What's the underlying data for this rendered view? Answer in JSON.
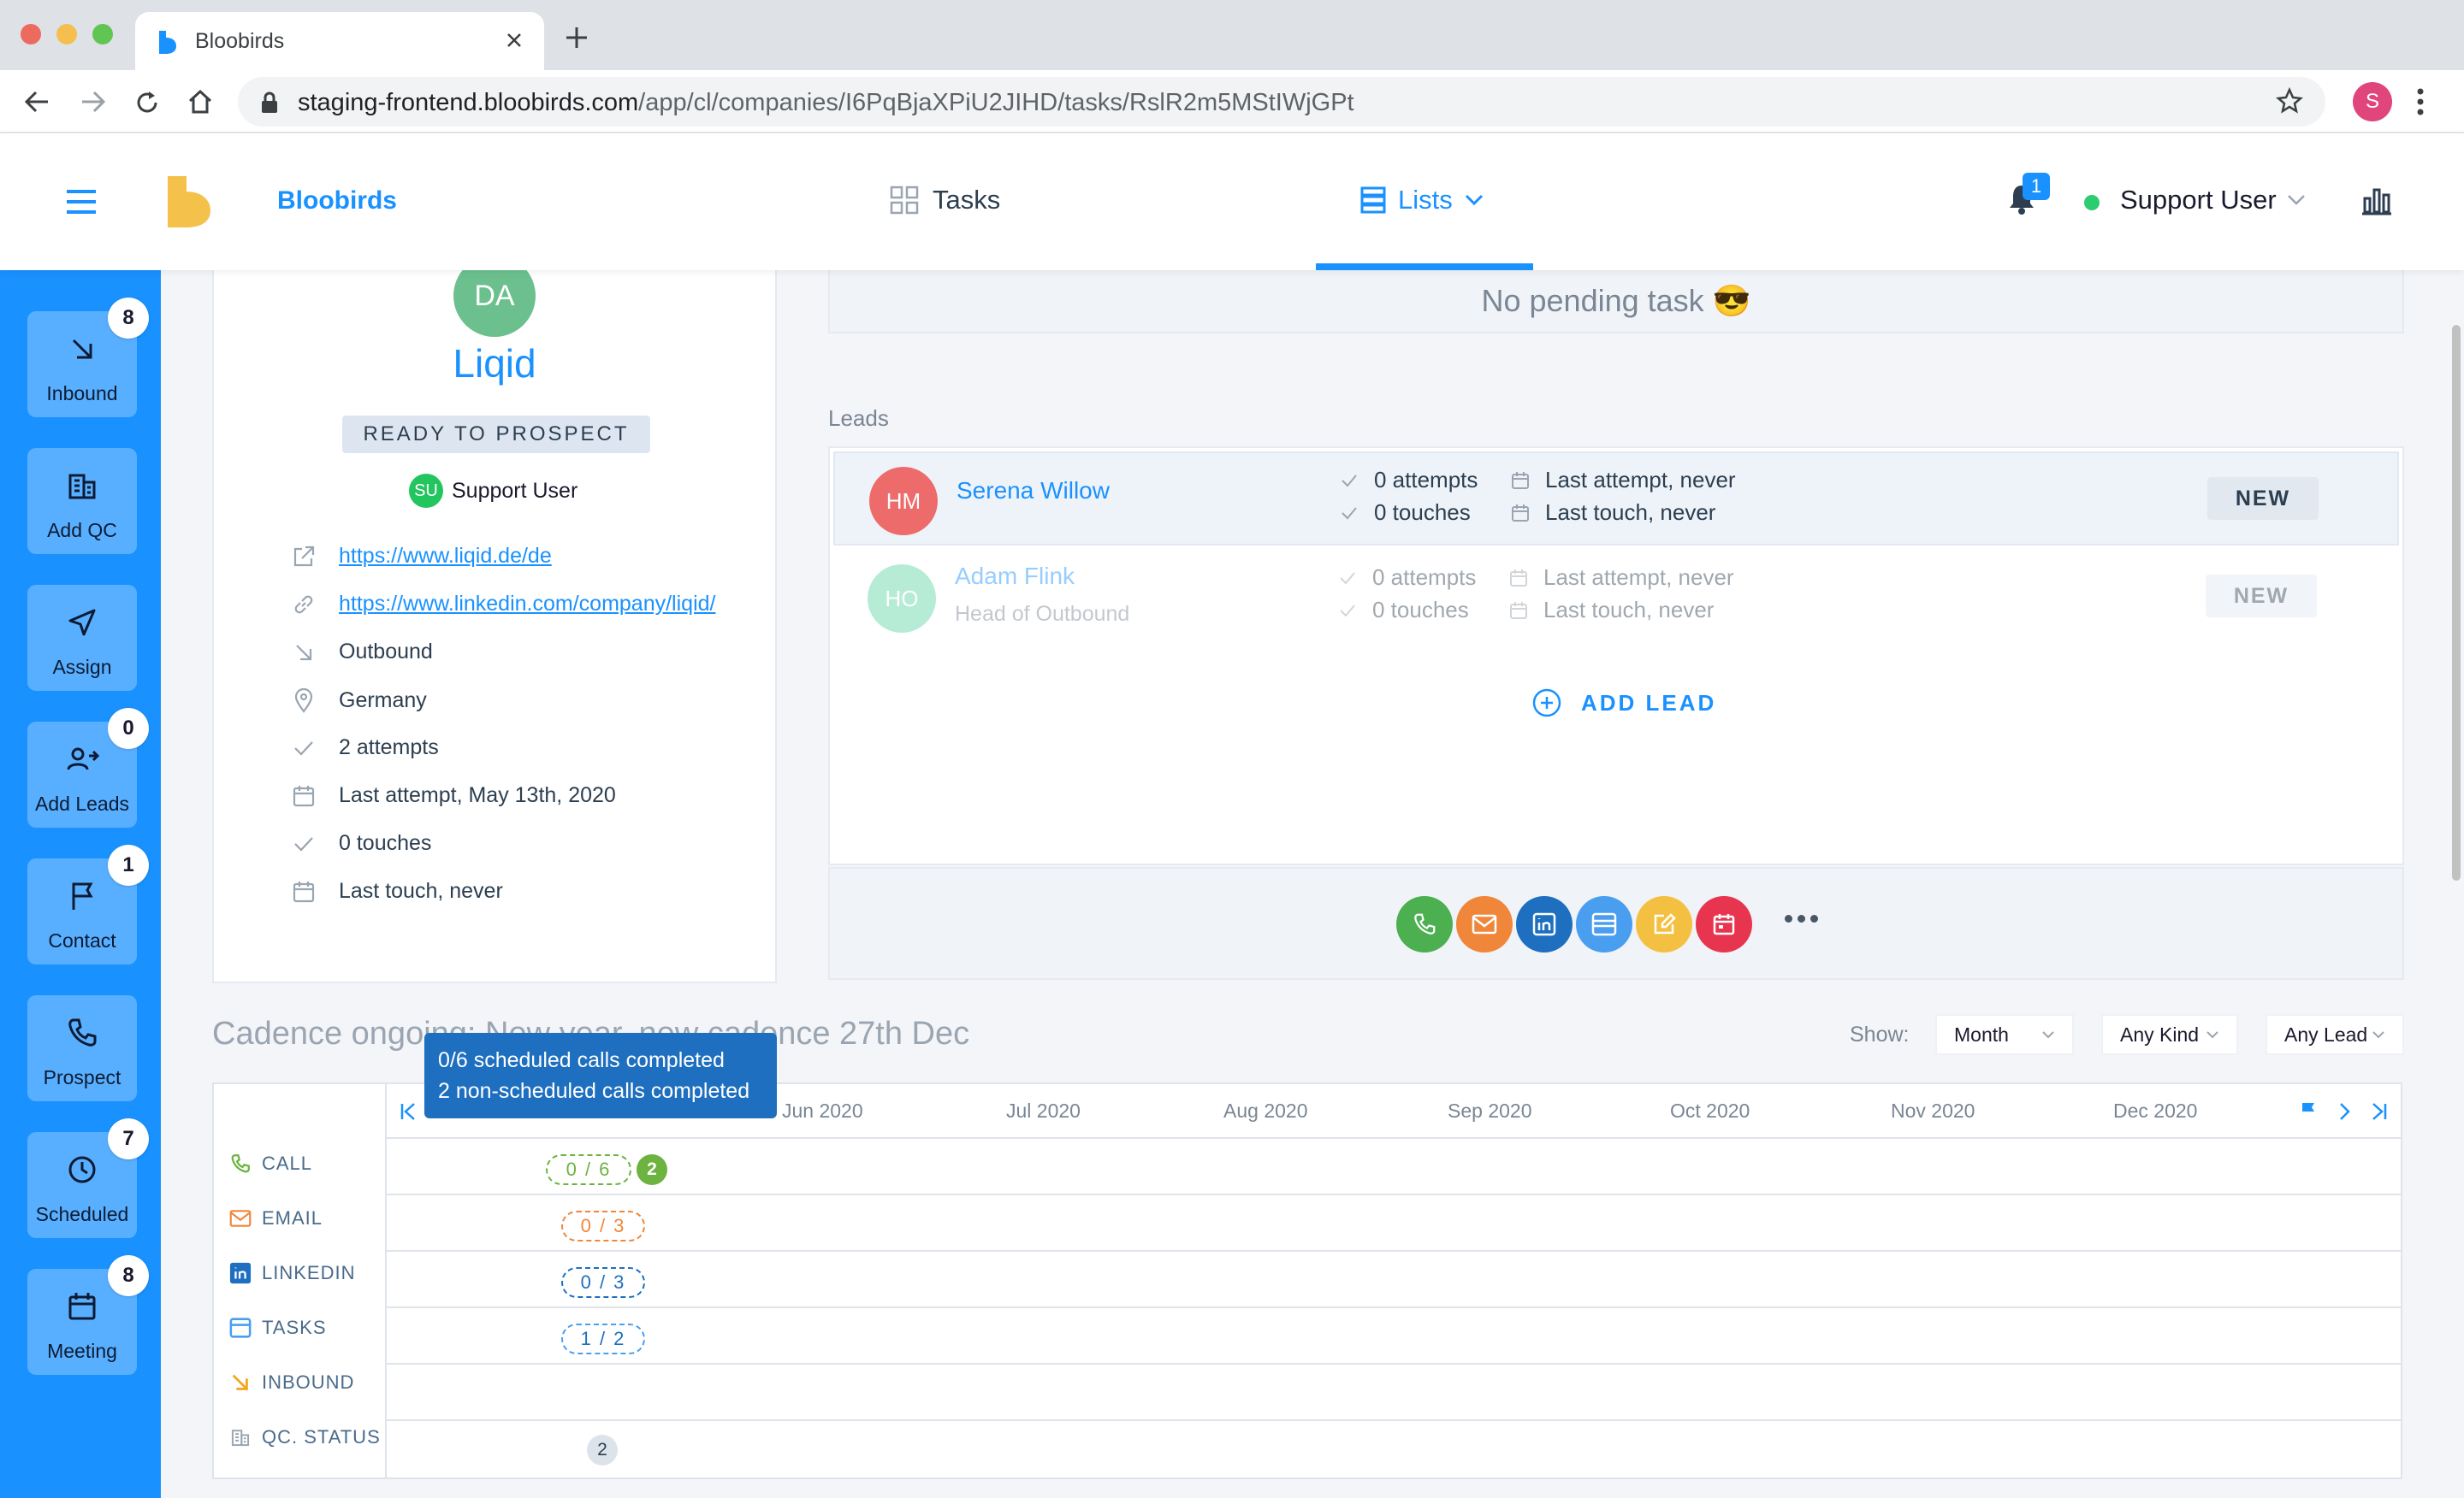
{
  "browser": {
    "tab_title": "Bloobirds",
    "url_host": "staging-frontend.bloobirds.com",
    "url_path": "/app/cl/companies/I6PqBjaXPiU2JIHD/tasks/RslR2m5MStIWjGPt",
    "profile_initial": "S"
  },
  "header": {
    "brand": "Bloobirds",
    "nav_tasks": "Tasks",
    "nav_lists": "Lists",
    "notifications_count": "1",
    "user_name": "Support User"
  },
  "sidebar": [
    {
      "label": "Inbound",
      "badge": "8",
      "icon": "arrow-down-right-icon"
    },
    {
      "label": "Add QC",
      "badge": "",
      "icon": "building-icon"
    },
    {
      "label": "Assign",
      "badge": "",
      "icon": "send-icon"
    },
    {
      "label": "Add Leads",
      "badge": "0",
      "icon": "add-user-icon"
    },
    {
      "label": "Contact",
      "badge": "1",
      "icon": "flag-icon"
    },
    {
      "label": "Prospect",
      "badge": "",
      "icon": "phone-icon"
    },
    {
      "label": "Scheduled",
      "badge": "7",
      "icon": "clock-icon"
    },
    {
      "label": "Meeting",
      "badge": "8",
      "icon": "calendar-icon"
    }
  ],
  "company": {
    "avatar": "DA",
    "name": "Liqid",
    "status": "READY TO PROSPECT",
    "owner_initials": "SU",
    "owner": "Support User",
    "website": "https://www.liqid.de/de",
    "linkedin": "https://www.linkedin.com/company/liqid/",
    "source": "Outbound",
    "country": "Germany",
    "attempts": "2 attempts",
    "last_attempt": "Last attempt, May 13th, 2020",
    "touches": "0 touches",
    "last_touch": "Last touch, never"
  },
  "pending": {
    "text": "No pending task",
    "emoji": "😎"
  },
  "leads": {
    "title": "Leads",
    "items": [
      {
        "initials": "HM",
        "name": "Serena Willow",
        "role": "",
        "attempts": "0 attempts",
        "touches": "0 touches",
        "last_attempt": "Last attempt, never",
        "last_touch": "Last touch, never",
        "badge": "NEW",
        "color": "#ee6b6b"
      },
      {
        "initials": "HO",
        "name": "Adam Flink",
        "role": "Head of Outbound",
        "attempts": "0 attempts",
        "touches": "0 touches",
        "last_attempt": "Last attempt, never",
        "last_touch": "Last touch, never",
        "badge": "NEW",
        "color": "#5fd3a6"
      }
    ],
    "add_label": "ADD LEAD"
  },
  "actions": [
    {
      "name": "call-action-button",
      "icon": "phone-icon",
      "color": "#4caf50"
    },
    {
      "name": "email-action-button",
      "icon": "mail-icon",
      "color": "#f0863a"
    },
    {
      "name": "linkedin-action-button",
      "icon": "linkedin-icon",
      "color": "#1e6fbf"
    },
    {
      "name": "task-action-button",
      "icon": "task-icon",
      "color": "#4a9eef"
    },
    {
      "name": "note-action-button",
      "icon": "edit-icon",
      "color": "#f4c041"
    },
    {
      "name": "meeting-action-button",
      "icon": "calendar-icon",
      "color": "#e8354f"
    }
  ],
  "cadence": {
    "title": "Cadence ongoing: New year, new cadence 27th Dec",
    "tooltip_line1": "0/6 scheduled calls completed",
    "tooltip_line2": "2 non-scheduled calls completed",
    "show_label": "Show:",
    "filters": [
      "Month",
      "Any Kind",
      "Any Lead"
    ],
    "months": [
      "Jun 2020",
      "Jul 2020",
      "Aug 2020",
      "Sep 2020",
      "Oct 2020",
      "Nov 2020",
      "Dec 2020"
    ],
    "rows": [
      {
        "label": "CALL",
        "pill": "0 / 6",
        "extra": "2",
        "color": "#6cb33f"
      },
      {
        "label": "EMAIL",
        "pill": "0 / 3",
        "extra": "",
        "color": "#f0863a"
      },
      {
        "label": "LINKEDIN",
        "pill": "0 / 3",
        "extra": "",
        "color": "#1e6fbf"
      },
      {
        "label": "TASKS",
        "pill": "1 / 2",
        "extra": "",
        "color": "#4a9eef"
      },
      {
        "label": "INBOUND",
        "pill": "",
        "extra": "",
        "color": "#f4a620"
      },
      {
        "label": "QC. STATUS",
        "pill": "",
        "extra": "2",
        "color": "#9aa5b1"
      }
    ]
  }
}
